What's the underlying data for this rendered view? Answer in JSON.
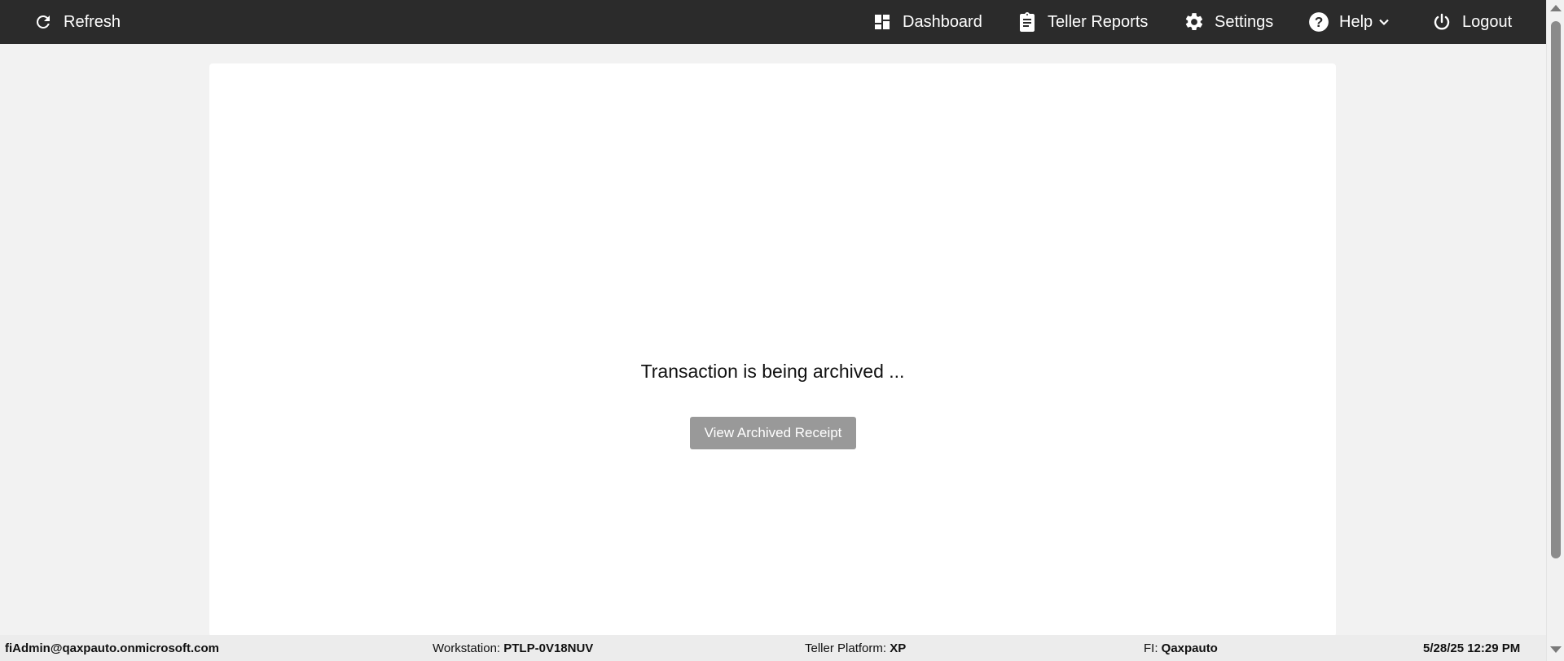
{
  "topbar": {
    "refresh_label": "Refresh",
    "dashboard_label": "Dashboard",
    "teller_reports_label": "Teller Reports",
    "settings_label": "Settings",
    "help_label": "Help",
    "logout_label": "Logout",
    "icons": [
      "refresh-icon",
      "dashboard-icon",
      "clipboard-icon",
      "gear-icon",
      "help-icon",
      "chevron-down-icon",
      "power-icon"
    ]
  },
  "main": {
    "status_message": "Transaction is being archived ...",
    "view_receipt_label": "View Archived Receipt"
  },
  "footer": {
    "user": "fiAdmin@qaxpauto.onmicrosoft.com",
    "workstation_label": "Workstation:",
    "workstation_value": "PTLP-0V18NUV",
    "teller_platform_label": "Teller Platform:",
    "teller_platform_value": "XP",
    "fi_label": "FI:",
    "fi_value": "Qaxpauto",
    "datetime": "5/28/25 12:29 PM"
  },
  "colors": {
    "topbar_bg": "#2b2b2b",
    "page_bg": "#f2f2f2",
    "card_bg": "#ffffff",
    "button_disabled_bg": "#999999"
  }
}
